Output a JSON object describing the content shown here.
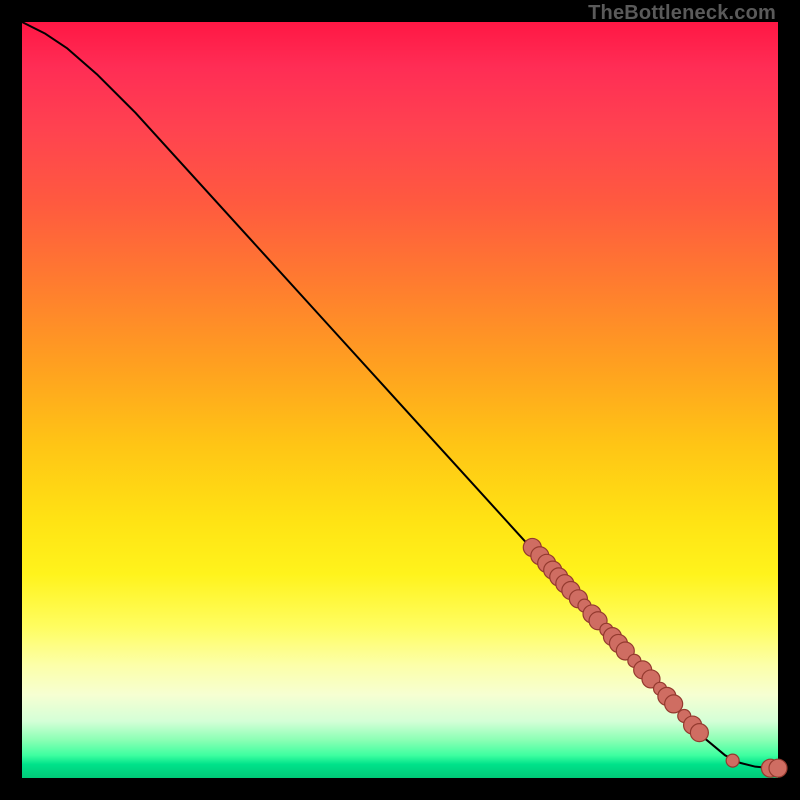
{
  "watermark": "TheBottleneck.com",
  "colors": {
    "point_fill": "#cf6d62",
    "point_stroke": "#943a2f",
    "curve": "#000000"
  },
  "chart_data": {
    "type": "line",
    "title": "",
    "xlabel": "",
    "ylabel": "",
    "xlim": [
      0,
      100
    ],
    "ylim": [
      0,
      100
    ],
    "grid": false,
    "legend": false,
    "series": [
      {
        "name": "curve",
        "x": [
          0,
          3,
          6,
          10,
          15,
          20,
          30,
          40,
          50,
          60,
          70,
          80,
          85,
          90,
          93,
          95,
          97,
          99,
          100
        ],
        "y": [
          100,
          98.5,
          96.5,
          93,
          88,
          82.5,
          71.5,
          60.5,
          49.5,
          38.5,
          27.5,
          16.5,
          11,
          5.5,
          3,
          2,
          1.5,
          1.3,
          1.3
        ]
      }
    ],
    "points": [
      {
        "x": 67.5,
        "y": 30.5,
        "size": "large"
      },
      {
        "x": 68.5,
        "y": 29.4,
        "size": "large"
      },
      {
        "x": 69.4,
        "y": 28.4,
        "size": "large"
      },
      {
        "x": 70.2,
        "y": 27.5,
        "size": "large"
      },
      {
        "x": 71.0,
        "y": 26.6,
        "size": "large"
      },
      {
        "x": 71.8,
        "y": 25.7,
        "size": "large"
      },
      {
        "x": 72.6,
        "y": 24.8,
        "size": "large"
      },
      {
        "x": 73.6,
        "y": 23.7,
        "size": "large"
      },
      {
        "x": 74.4,
        "y": 22.8,
        "size": "small"
      },
      {
        "x": 75.4,
        "y": 21.7,
        "size": "large"
      },
      {
        "x": 76.2,
        "y": 20.8,
        "size": "large"
      },
      {
        "x": 77.3,
        "y": 19.6,
        "size": "small"
      },
      {
        "x": 78.1,
        "y": 18.7,
        "size": "large"
      },
      {
        "x": 78.9,
        "y": 17.8,
        "size": "large"
      },
      {
        "x": 79.8,
        "y": 16.8,
        "size": "large"
      },
      {
        "x": 81.0,
        "y": 15.5,
        "size": "small"
      },
      {
        "x": 82.1,
        "y": 14.3,
        "size": "large"
      },
      {
        "x": 83.2,
        "y": 13.1,
        "size": "large"
      },
      {
        "x": 84.4,
        "y": 11.8,
        "size": "small"
      },
      {
        "x": 85.3,
        "y": 10.8,
        "size": "large"
      },
      {
        "x": 86.2,
        "y": 9.8,
        "size": "large"
      },
      {
        "x": 87.6,
        "y": 8.2,
        "size": "small"
      },
      {
        "x": 88.7,
        "y": 7.0,
        "size": "large"
      },
      {
        "x": 89.6,
        "y": 6.0,
        "size": "large"
      },
      {
        "x": 94.0,
        "y": 2.3,
        "size": "small"
      },
      {
        "x": 99.0,
        "y": 1.3,
        "size": "large"
      },
      {
        "x": 100.0,
        "y": 1.3,
        "size": "large"
      }
    ]
  }
}
